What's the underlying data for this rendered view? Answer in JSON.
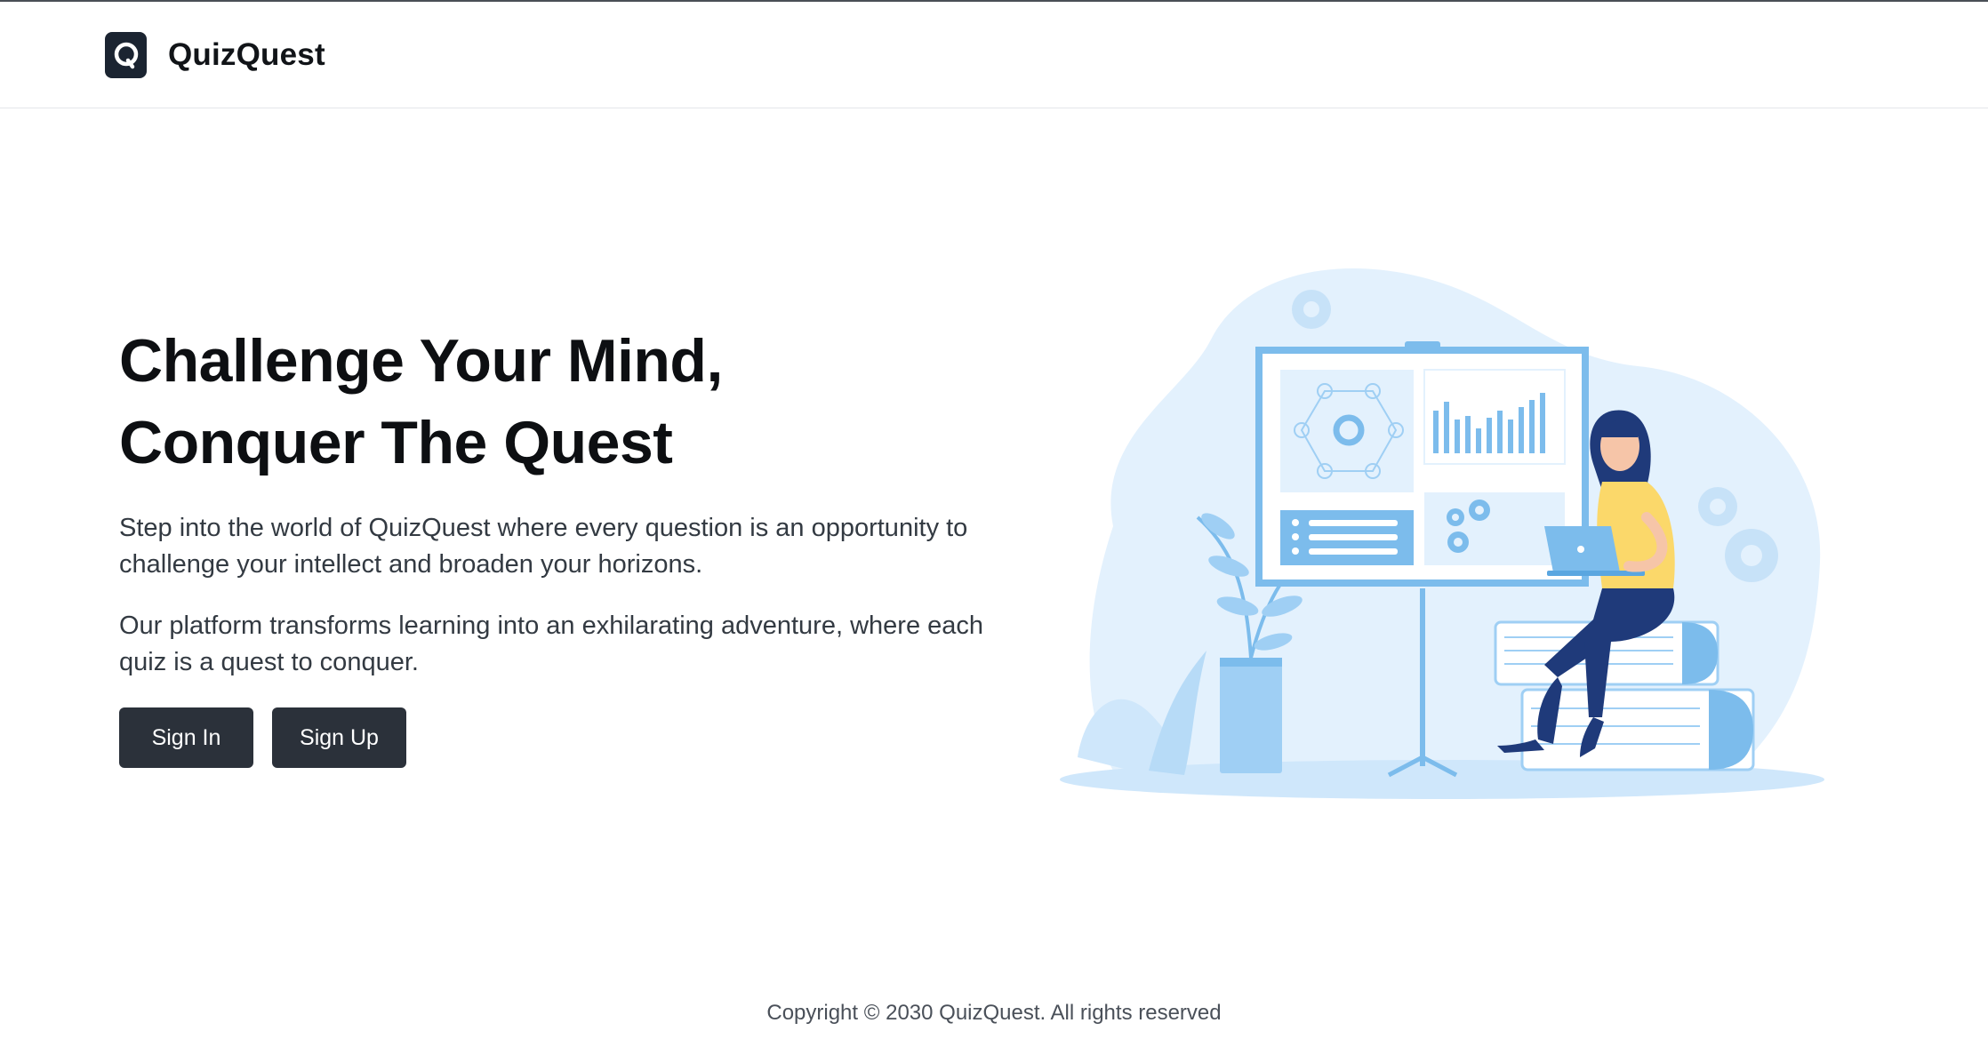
{
  "brand": {
    "name": "QuizQuest",
    "logo_icon": "q-logo-icon",
    "logo_color": "#1b2431"
  },
  "hero": {
    "headline_line1": "Challenge Your Mind,",
    "headline_line2": "Conquer The Quest",
    "paragraph1": "Step into the world of QuizQuest where every question is an opportunity to challenge your intellect and broaden your horizons.",
    "paragraph2": "Our platform transforms learning into an exhilarating adventure, where each quiz is a quest to conquer.",
    "sign_in_label": "Sign In",
    "sign_up_label": "Sign Up",
    "button_color": "#2b313a",
    "illustration": "woman-with-laptop-on-books-illustration"
  },
  "footer": {
    "copyright": "Copyright © 2030 QuizQuest. All rights reserved"
  },
  "colors": {
    "accent_light_blue": "#dbeefc",
    "accent_blue": "#7cbcec",
    "accent_dark_blue": "#1f3a7a",
    "accent_yellow": "#fbd86a"
  }
}
